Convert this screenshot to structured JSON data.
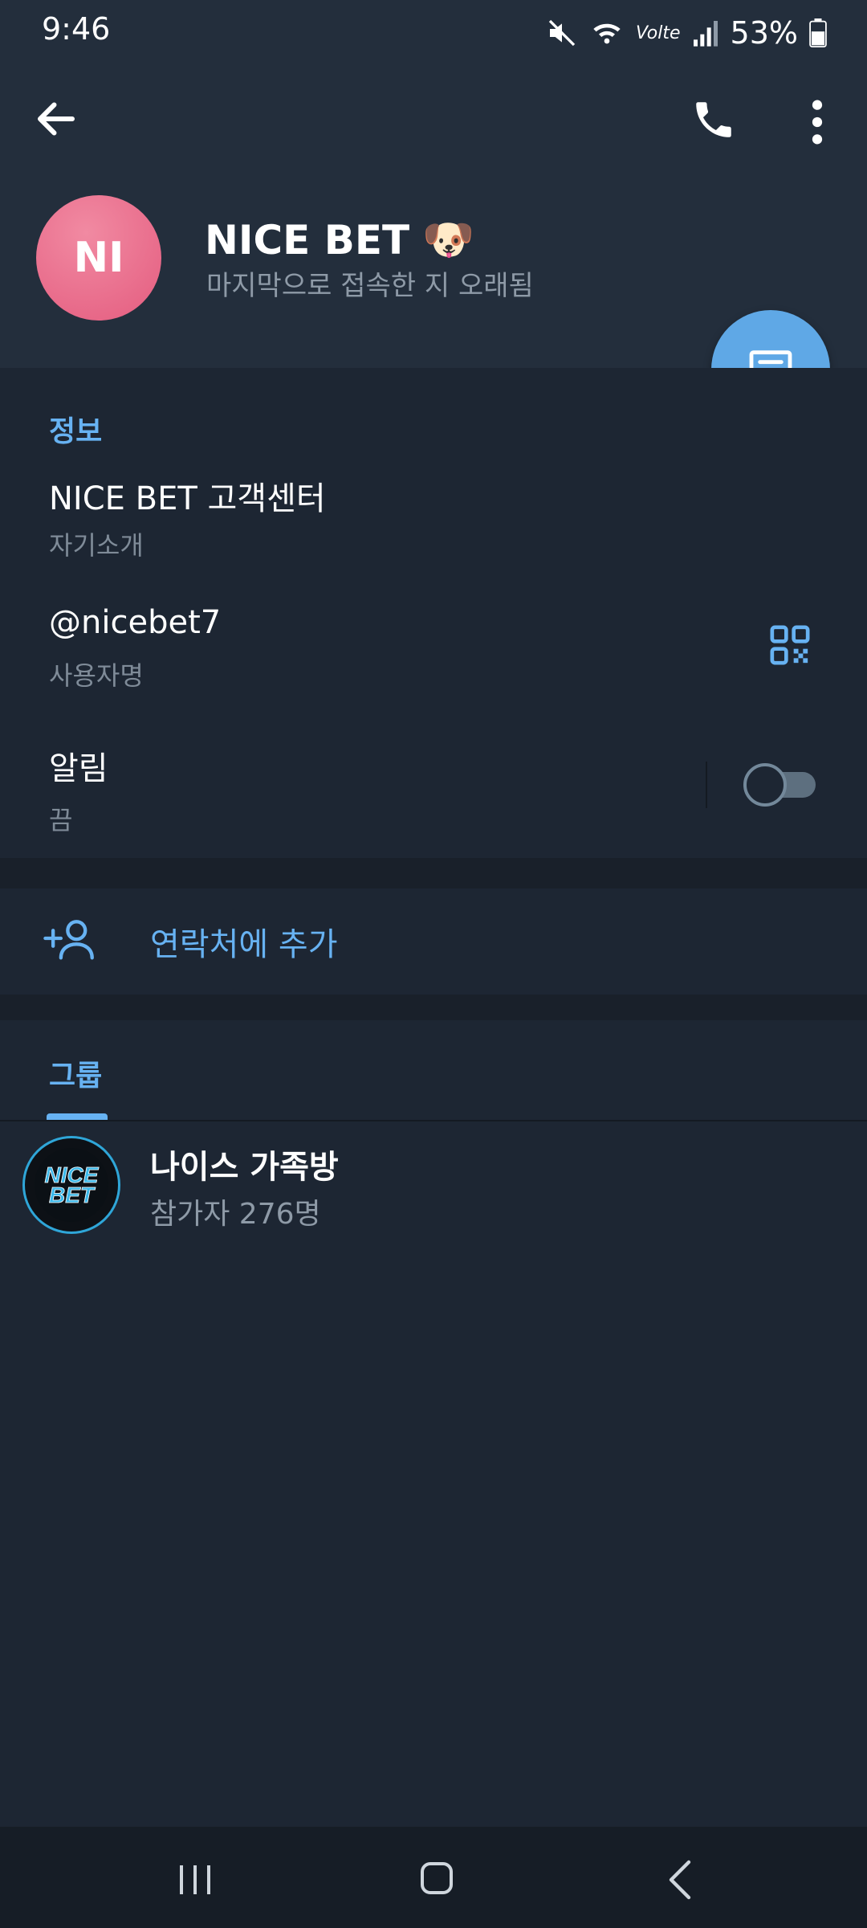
{
  "status_bar": {
    "time": "9:46",
    "battery_text": "53%",
    "icons": [
      "mute-icon",
      "wifi-icon",
      "volte-icon",
      "signal-icon",
      "battery-icon"
    ],
    "volte_label": "Volte"
  },
  "header": {
    "avatar_initials": "NI",
    "name": "NICE BET",
    "name_emoji": "🐶",
    "last_seen": "마지막으로 접속한 지 오래됨",
    "icons": [
      "back-arrow-icon",
      "phone-icon",
      "more-vert-icon",
      "message-icon"
    ]
  },
  "info": {
    "section_title": "정보",
    "bio_value": "NICE BET 고객센터",
    "bio_label": "자기소개",
    "username_value": "@nicebet7",
    "username_label": "사용자명",
    "notifications_value": "알림",
    "notifications_label": "끔",
    "notifications_enabled": false
  },
  "add_contact": {
    "label": "연락처에 추가"
  },
  "groups": {
    "tab_label": "그룹",
    "items": [
      {
        "name": "나이스 가족방",
        "members": "참가자 276명",
        "logo_text": "NICE BET"
      }
    ]
  },
  "colors": {
    "accent": "#67b2f2",
    "header_bg": "#232e3c",
    "body_bg": "#1d2633",
    "avatar": "#e45c7f",
    "fab": "#5fa8e6"
  }
}
